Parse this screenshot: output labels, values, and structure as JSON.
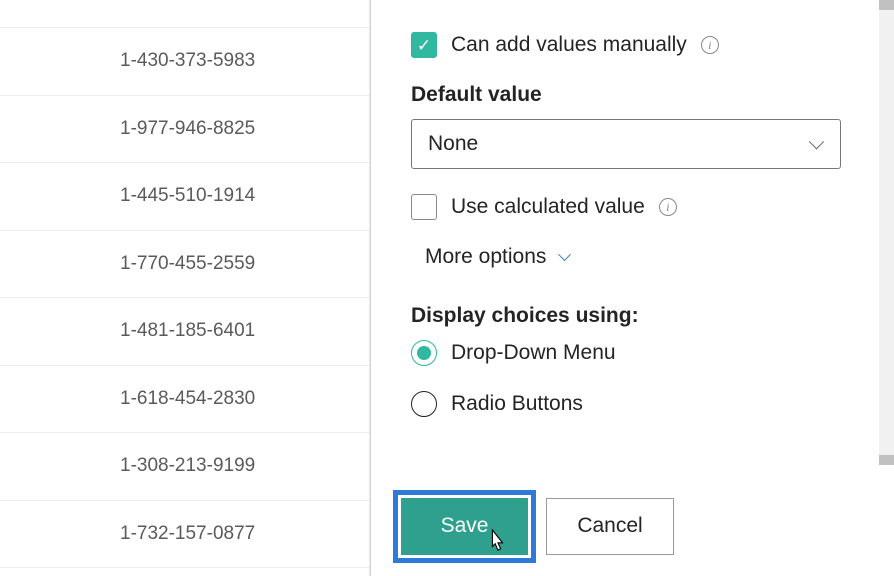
{
  "list": {
    "rows": [
      "",
      "1-430-373-5983",
      "1-977-946-8825",
      "1-445-510-1914",
      "1-770-455-2559",
      "1-481-185-6401",
      "1-618-454-2830",
      "1-308-213-9199",
      "1-732-157-0877"
    ]
  },
  "panel": {
    "can_add_label": "Can add values manually",
    "default_value_label": "Default value",
    "default_value": "None",
    "use_calculated_label": "Use calculated value",
    "more_options_label": "More options",
    "display_choices_label": "Display choices using:",
    "choices": [
      {
        "label": "Drop-Down Menu",
        "selected": true
      },
      {
        "label": "Radio Buttons",
        "selected": false
      }
    ]
  },
  "footer": {
    "save_label": "Save",
    "cancel_label": "Cancel"
  }
}
